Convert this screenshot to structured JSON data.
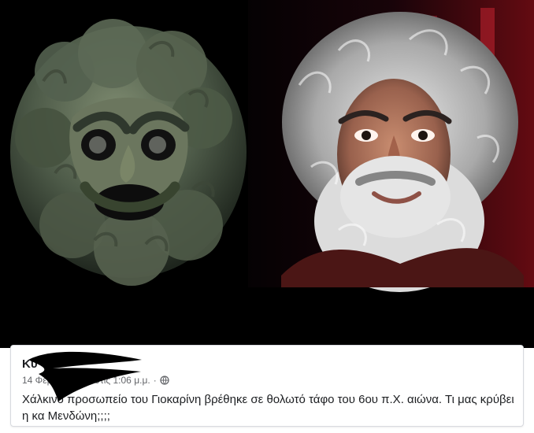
{
  "post": {
    "author_visible": "Κύ",
    "timestamp_visible": "14 Φεβρουαρίου στις 1:06 μ.μ.",
    "separator": "·",
    "privacy_icon": "globe-icon",
    "body": "Χάλκινο προσωπείο του Γιοκαρίνη βρέθηκε σε θολωτό τάφο του 6ου π.Χ. αιώνα. Τι μας κρύβει η κα Μενδώνη;;;;"
  },
  "colors": {
    "card_background": "#ffffff",
    "primary_text": "#1c1e21",
    "secondary_text": "#65676b",
    "photo_background": "#000000",
    "redaction": "#000000"
  }
}
